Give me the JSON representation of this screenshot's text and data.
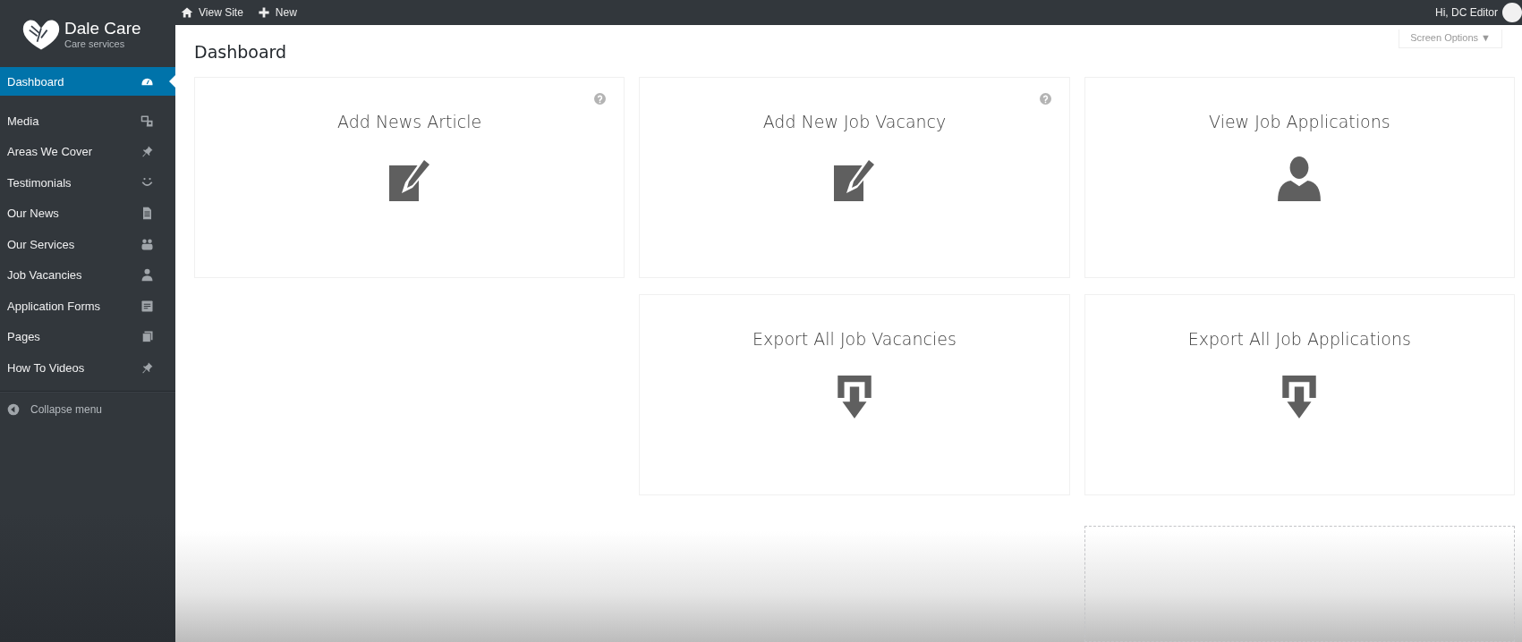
{
  "brand": {
    "name": "Dale Care",
    "tagline": "Care services"
  },
  "toolbar": {
    "items": [
      "View Site",
      "New"
    ],
    "greeting": "Hi, DC Editor"
  },
  "sidebar": {
    "items": [
      {
        "label": "Dashboard",
        "selected": true
      },
      {
        "label": "Media",
        "selected": false
      },
      {
        "label": "Areas We Cover",
        "selected": false
      },
      {
        "label": "Testimonials",
        "selected": false
      },
      {
        "label": "Our News",
        "selected": false
      },
      {
        "label": "Our Services",
        "selected": false
      },
      {
        "label": "Job Vacancies",
        "selected": false
      },
      {
        "label": "Application Forms",
        "selected": false
      },
      {
        "label": "Pages",
        "selected": false
      },
      {
        "label": "How To Videos",
        "selected": false
      }
    ],
    "collapse": "Collapse menu"
  },
  "page": {
    "title": "Dashboard",
    "screen_options": "Screen Options ▼"
  },
  "columns": [
    {
      "cards": [
        {
          "kind": "edit",
          "title": "Add News Article",
          "help": true
        }
      ]
    },
    {
      "cards": [
        {
          "kind": "edit",
          "title": "Add New Job Vacancy",
          "help": true
        },
        {
          "kind": "export",
          "title": "Export All Job Vacancies",
          "help": false
        }
      ]
    },
    {
      "cards": [
        {
          "kind": "person",
          "title": "View Job Applications",
          "help": false
        },
        {
          "kind": "export",
          "title": "Export All Job Applications",
          "help": false
        },
        {
          "kind": "drop_zone"
        }
      ]
    }
  ]
}
